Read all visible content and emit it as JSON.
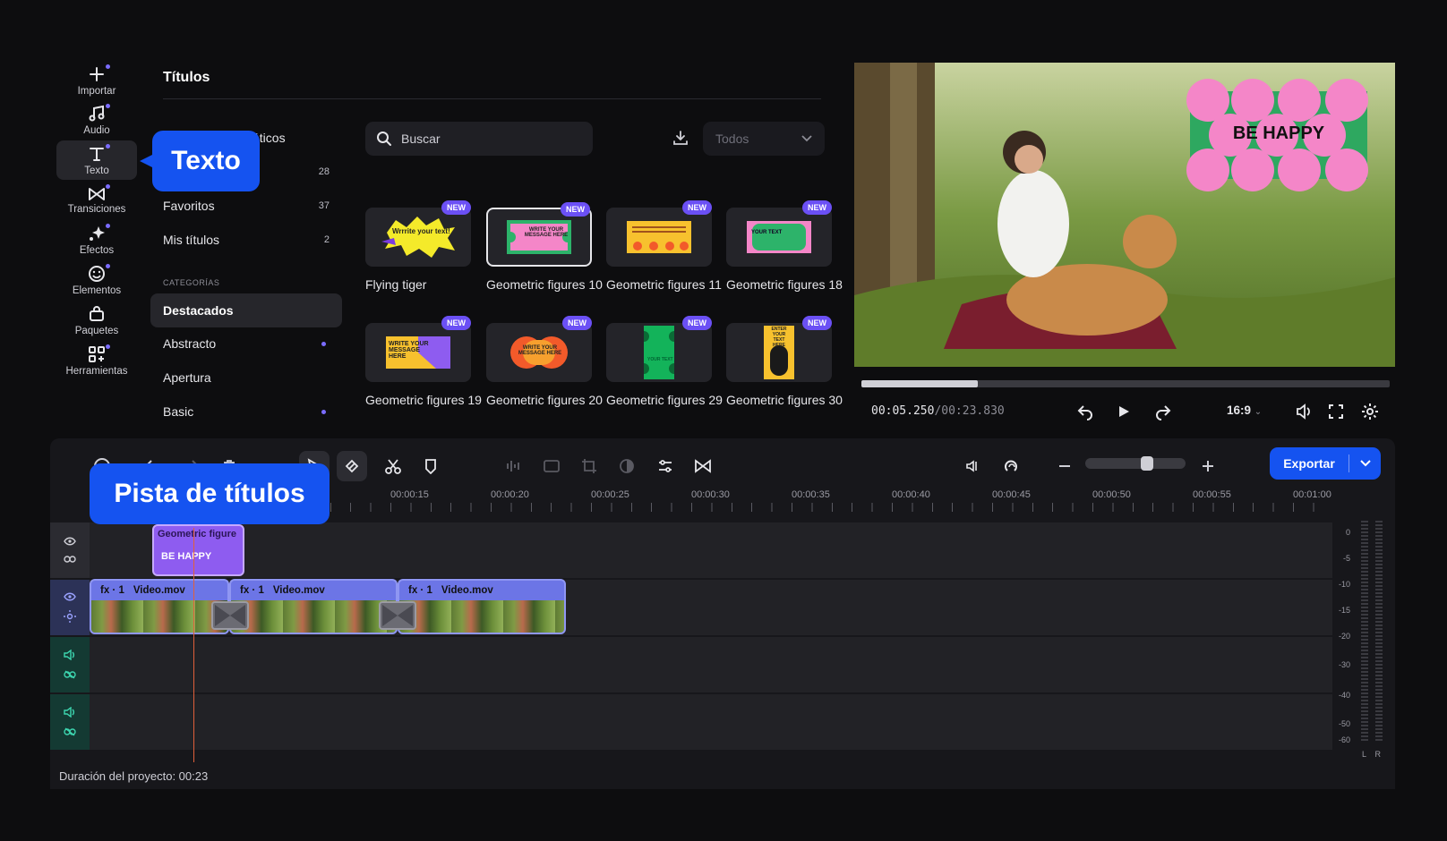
{
  "sidebar": {
    "items": [
      {
        "label": "Importar",
        "icon": "plus-icon"
      },
      {
        "label": "Audio",
        "icon": "music-note-icon"
      },
      {
        "label": "Texto",
        "icon": "text-icon"
      },
      {
        "label": "Transiciones",
        "icon": "bowtie-icon"
      },
      {
        "label": "Efectos",
        "icon": "sparkle-icon"
      },
      {
        "label": "Elementos",
        "icon": "smiley-icon"
      },
      {
        "label": "Paquetes",
        "icon": "bag-icon"
      },
      {
        "label": "Herramientas",
        "icon": "grid-plus-icon"
      }
    ]
  },
  "titles_panel": {
    "title": "Títulos",
    "hidden_item_fragment": "áticos",
    "hidden_item_count": "28",
    "favorites": {
      "label": "Favoritos",
      "count": "37"
    },
    "my_titles": {
      "label": "Mis títulos",
      "count": "2"
    },
    "categories_heading": "CATEGORÍAS",
    "categories": [
      {
        "label": "Destacados",
        "active": true
      },
      {
        "label": "Abstracto",
        "dot": true
      },
      {
        "label": "Apertura"
      },
      {
        "label": "Basic",
        "dot": true
      }
    ],
    "search_placeholder": "Buscar",
    "filter_value": "Todos",
    "new_badge": "NEW",
    "cards": [
      {
        "name": "Flying tiger",
        "thumb_text": "Wrrrite your text!"
      },
      {
        "name": "Geometric figures 10",
        "thumb_text": "WRITE YOUR MESSAGE HERE",
        "selected": true
      },
      {
        "name": "Geometric figures 11",
        "thumb_text": ""
      },
      {
        "name": "Geometric figures 18",
        "thumb_text": "YOUR TEXT"
      },
      {
        "name": "Geometric figures 19",
        "thumb_text": "WRITE YOUR MESSAGE HERE"
      },
      {
        "name": "Geometric figures 20",
        "thumb_text": "WRITE YOUR MESSAGE HERE"
      },
      {
        "name": "Geometric figures 29",
        "thumb_text": "YOUR TEXT"
      },
      {
        "name": "Geometric figures 30",
        "thumb_text": "ENTER YOUR TEXT HERE"
      }
    ]
  },
  "preview": {
    "overlay_text": "BE HAPPY",
    "time_current": "00:05.250",
    "time_total": "/00:23.830",
    "progress": 0.22,
    "aspect_ratio": "16:9"
  },
  "timeline": {
    "export_label": "Exportar",
    "ruler": [
      "00:00:15",
      "00:00:20",
      "00:00:25",
      "00:00:30",
      "00:00:35",
      "00:00:40",
      "00:00:45",
      "00:00:50",
      "00:00:55",
      "00:01:00"
    ],
    "title_clip": {
      "name": "Geometric figure",
      "text": "BE HAPPY"
    },
    "video_clips": [
      {
        "fx": "fx · 1",
        "name": "Video.mov"
      },
      {
        "fx": "fx · 1",
        "name": "Video.mov"
      },
      {
        "fx": "fx · 1",
        "name": "Video.mov"
      }
    ],
    "meter_labels": [
      "0",
      "-5",
      "-10",
      "-15",
      "-20",
      "-30",
      "-40",
      "-50",
      "-60"
    ],
    "meter_lr": [
      "L",
      "R"
    ],
    "project_duration": "Duración del proyecto: 00:23"
  },
  "callouts": {
    "text": "Texto",
    "titles_track": "Pista de títulos"
  },
  "colors": {
    "accent": "#1553f0",
    "badge": "#6b50f5",
    "video_clip": "#6c75e6",
    "title_clip": "#8e5cf0",
    "playhead": "#e0603a"
  }
}
